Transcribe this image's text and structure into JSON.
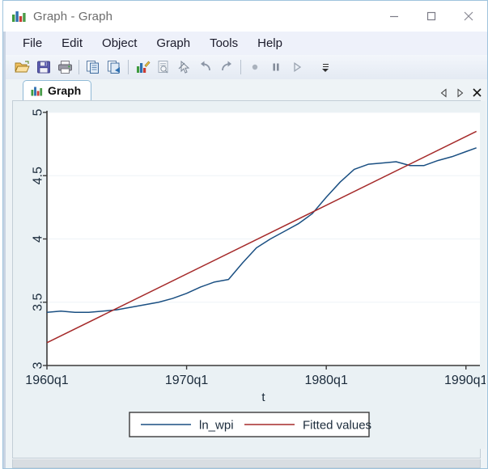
{
  "window": {
    "title": "Graph - Graph",
    "icon": "bar-chart-icon",
    "controls": {
      "minimize": "—",
      "maximize": "□",
      "close": "✕"
    }
  },
  "menu": {
    "items": [
      {
        "label": "File"
      },
      {
        "label": "Edit"
      },
      {
        "label": "Object"
      },
      {
        "label": "Graph"
      },
      {
        "label": "Tools"
      },
      {
        "label": "Help"
      }
    ]
  },
  "toolbar": {
    "buttons": [
      {
        "name": "open-icon",
        "tip": "Open"
      },
      {
        "name": "save-icon",
        "tip": "Save"
      },
      {
        "name": "print-icon",
        "tip": "Print"
      },
      {
        "name": "copy-icon",
        "tip": "Copy"
      },
      {
        "name": "paste-icon",
        "tip": "Paste"
      },
      {
        "name": "graph-editor-icon",
        "tip": "Start Graph Editor"
      },
      {
        "name": "preview-icon",
        "tip": "Preview"
      },
      {
        "name": "pointer-icon",
        "tip": "Pointer tool"
      },
      {
        "name": "undo-icon",
        "tip": "Undo"
      },
      {
        "name": "redo-icon",
        "tip": "Redo"
      },
      {
        "name": "record-icon",
        "tip": "Record"
      },
      {
        "name": "pause-icon",
        "tip": "Pause"
      },
      {
        "name": "play-icon",
        "tip": "Play"
      }
    ],
    "overflow": "toolbar-overflow"
  },
  "tabs": {
    "items": [
      {
        "label": "Graph",
        "icon": "bar-chart-icon",
        "active": true
      }
    ],
    "nav": {
      "prev": "◁",
      "next": "▷",
      "close": "✕"
    }
  },
  "chart_data": {
    "type": "line",
    "title": "",
    "xlabel": "t",
    "ylabel": "",
    "xlim": [
      1960.0,
      1991.0
    ],
    "ylim": [
      3,
      5
    ],
    "xticks": [
      1960,
      1970,
      1980,
      1990
    ],
    "xticklabels": [
      "1960q1",
      "1970q1",
      "1980q1",
      "1990q1"
    ],
    "yticks": [
      3,
      3.5,
      4,
      4.5,
      5
    ],
    "yticklabels": [
      "3",
      "3.5",
      "4",
      "4.5",
      "5"
    ],
    "grid": "horizontal",
    "legend_position": "bottom",
    "colors": {
      "ln_wpi": "#1a4f82",
      "fitted": "#a52a2a",
      "axis": "#3a3a3a",
      "grid": "#edf3f7",
      "plot_background": "#ffffff",
      "graph_background": "#eaf1f4"
    },
    "series": [
      {
        "name": "ln_wpi",
        "color": "#1a4f82",
        "x": [
          1960.0,
          1961.0,
          1962.0,
          1963.0,
          1964.0,
          1965.0,
          1966.0,
          1967.0,
          1968.0,
          1969.0,
          1970.0,
          1971.0,
          1972.0,
          1973.0,
          1974.0,
          1975.0,
          1976.0,
          1977.0,
          1978.0,
          1979.0,
          1980.0,
          1981.0,
          1982.0,
          1983.0,
          1984.0,
          1985.0,
          1986.0,
          1987.0,
          1988.0,
          1989.0,
          1990.0,
          1990.75
        ],
        "y": [
          3.42,
          3.43,
          3.42,
          3.42,
          3.43,
          3.44,
          3.46,
          3.48,
          3.5,
          3.53,
          3.57,
          3.62,
          3.66,
          3.68,
          3.81,
          3.93,
          4.0,
          4.06,
          4.12,
          4.2,
          4.33,
          4.45,
          4.55,
          4.59,
          4.6,
          4.61,
          4.58,
          4.58,
          4.62,
          4.65,
          4.69,
          4.72
        ]
      },
      {
        "name": "Fitted values",
        "color": "#a52a2a",
        "x": [
          1960.0,
          1990.75
        ],
        "y": [
          3.18,
          4.85
        ]
      }
    ],
    "legend": [
      {
        "label": "ln_wpi",
        "color": "#1a4f82"
      },
      {
        "label": "Fitted values",
        "color": "#a52a2a"
      }
    ]
  }
}
